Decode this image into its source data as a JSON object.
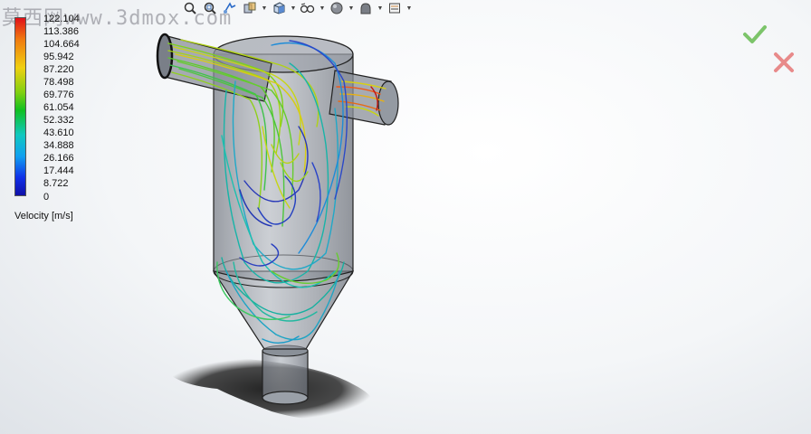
{
  "watermark": {
    "cn": "莫西网",
    "domain": "www.3dmox.com"
  },
  "legend": {
    "caption": "Velocity [m/s]",
    "values": [
      "122.104",
      "113.386",
      "104.664",
      "95.942",
      "87.220",
      "78.498",
      "69.776",
      "61.054",
      "52.332",
      "43.610",
      "34.888",
      "26.166",
      "17.444",
      "8.722",
      "0"
    ]
  },
  "toolbar": {
    "icons": [
      "zoom-to-fit-icon",
      "zoom-to-area-icon",
      "previous-view-icon",
      "section-view-icon",
      "view-orientation-icon",
      "display-style-icon",
      "hide-show-items-icon",
      "edit-appearance-icon",
      "apply-scene-icon",
      "view-settings-icon"
    ]
  },
  "colors": {
    "accept": "#4caf50",
    "reject": "#e06a6a"
  }
}
